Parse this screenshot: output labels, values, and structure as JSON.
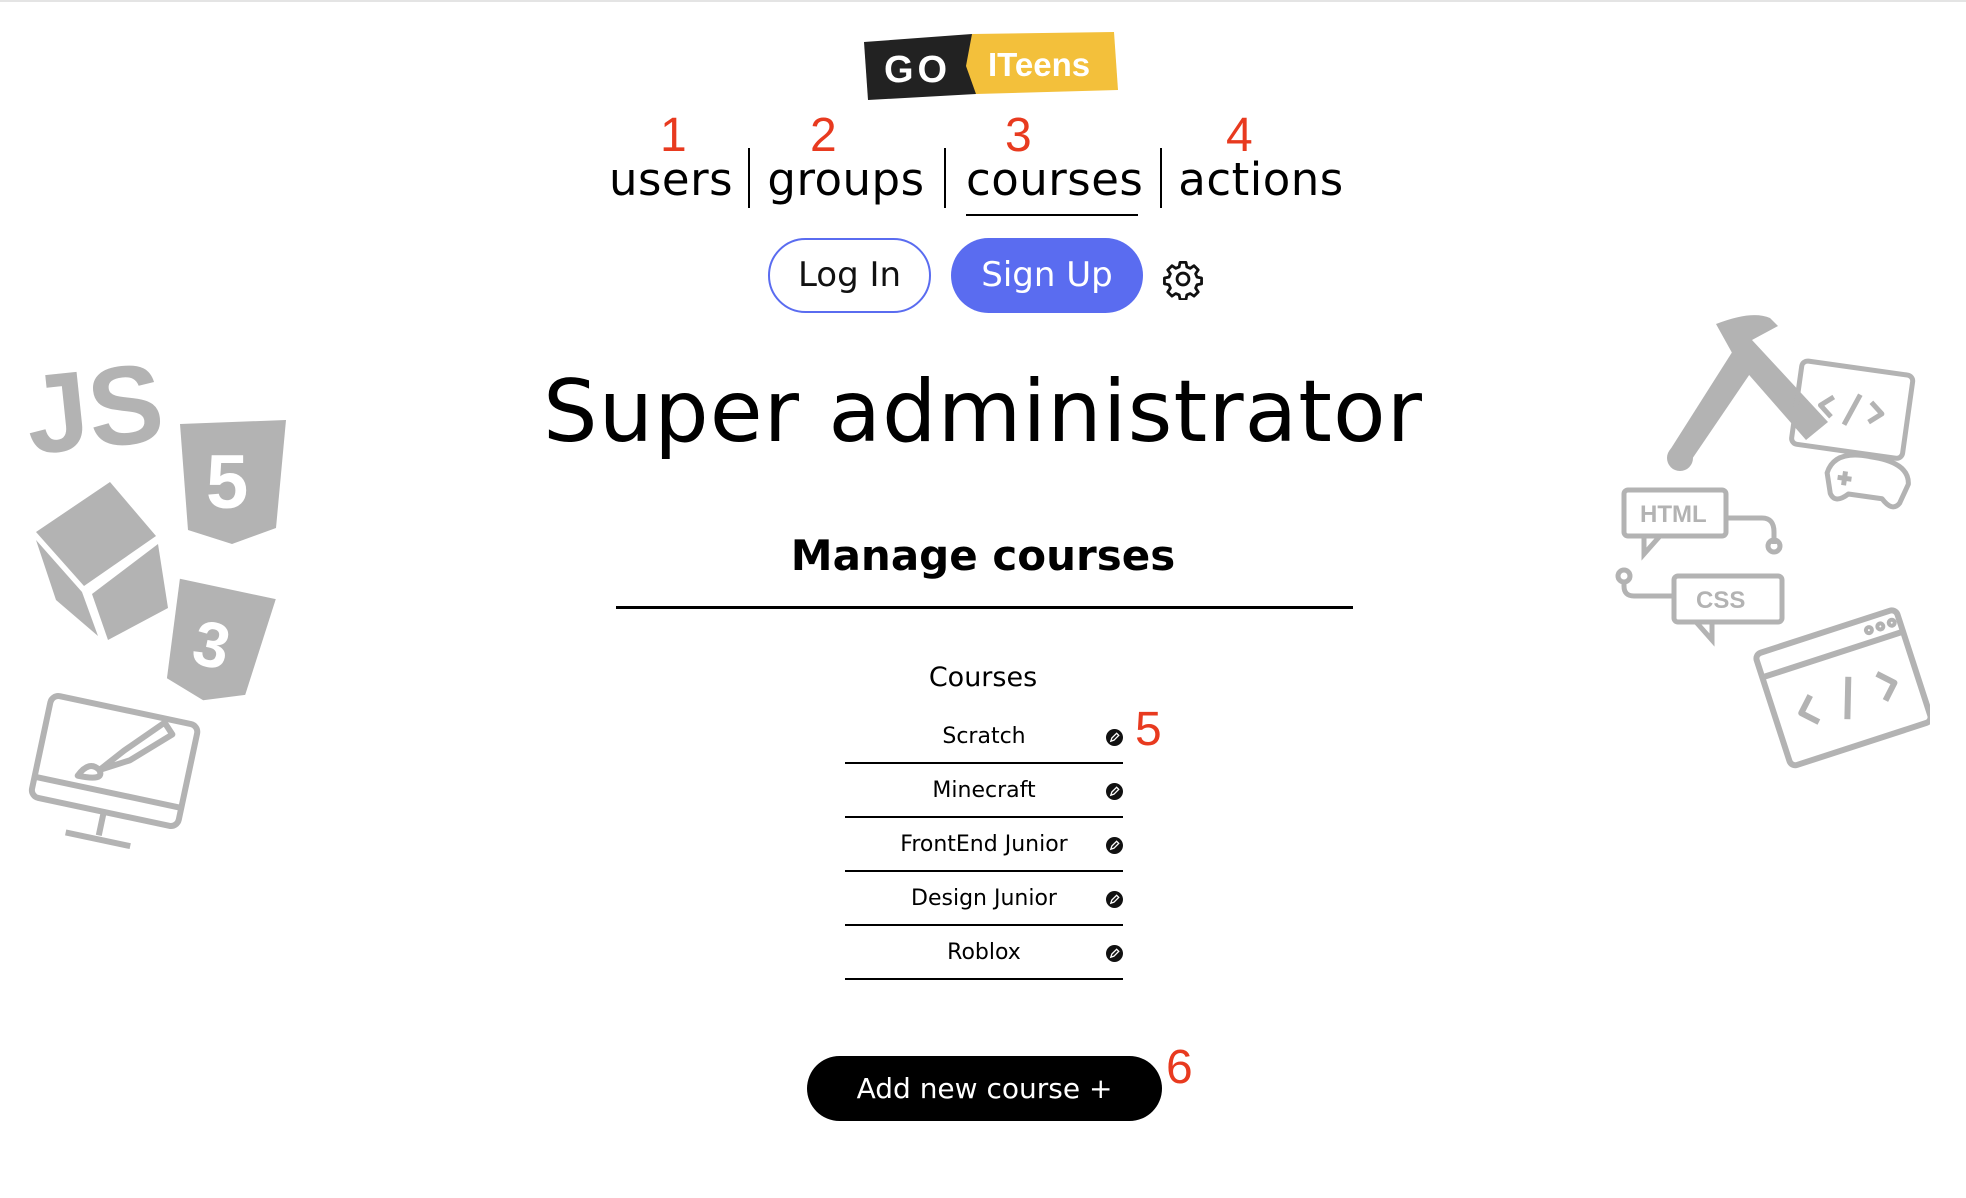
{
  "logo": {
    "left_text": "GO",
    "right_text": "ITeens",
    "dark_color": "#222222",
    "accent_color": "#f3c03b"
  },
  "nav": {
    "items": [
      {
        "label": "users",
        "annotation": "1"
      },
      {
        "label": "groups",
        "annotation": "2"
      },
      {
        "label": "courses",
        "annotation": "3",
        "active": true
      },
      {
        "label": "actions",
        "annotation": "4"
      }
    ]
  },
  "auth": {
    "login_label": "Log In",
    "signup_label": "Sign Up",
    "settings_icon": "gear-icon"
  },
  "page": {
    "title": "Super administrator",
    "section_title": "Manage courses"
  },
  "courses": {
    "title": "Courses",
    "items": [
      "Scratch",
      "Minecraft",
      "FrontEnd Junior",
      "Design Junior",
      "Roblox"
    ],
    "edit_annotation": "5"
  },
  "add_course": {
    "label": "Add new course +",
    "annotation": "6"
  },
  "decorations": {
    "left": [
      "js-logo-icon",
      "html5-icon",
      "cube-icon",
      "css3-icon",
      "monitor-brush-icon"
    ],
    "right": [
      "pickaxe-icon",
      "html-css-bubbles-icon",
      "code-gamepad-icon",
      "browser-code-icon"
    ],
    "html_label": "HTML",
    "css_label": "CSS",
    "js_label": "JS"
  },
  "colors": {
    "primary": "#5a6cf0",
    "annotation": "#e83a1f",
    "deco_gray": "#b3b3b3"
  }
}
